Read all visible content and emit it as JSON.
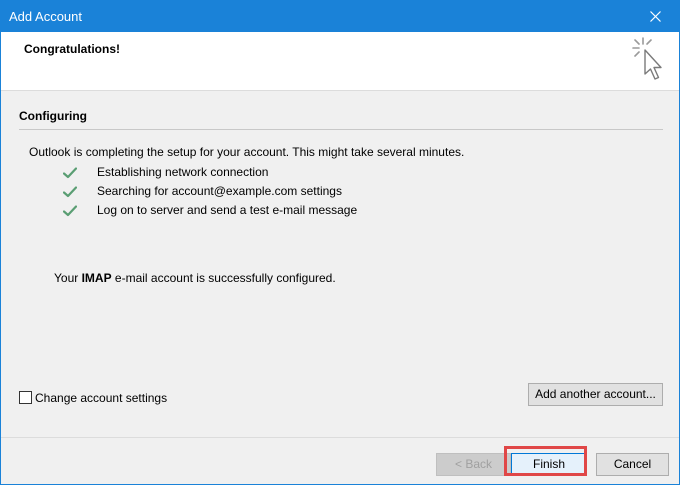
{
  "window": {
    "title": "Add Account",
    "close_icon": "close-icon",
    "accent_color": "#1a82d8"
  },
  "banner": {
    "heading": "Congratulations!",
    "icon": "wizard-cursor-icon"
  },
  "section": {
    "title": "Configuring",
    "intro": "Outlook is completing the setup for your account. This might take several minutes.",
    "steps": [
      {
        "label": "Establishing network connection",
        "status": "done",
        "icon": "check-icon"
      },
      {
        "label": "Searching for account@example.com settings",
        "status": "done",
        "icon": "check-icon"
      },
      {
        "label": "Log on to server and send a test e-mail message",
        "status": "done",
        "icon": "check-icon"
      }
    ],
    "success_prefix": "Your ",
    "success_bold": "IMAP",
    "success_suffix": " e-mail account is successfully configured."
  },
  "options": {
    "change_settings_label": "Change account settings",
    "change_settings_checked": false,
    "add_another_label": "Add another account..."
  },
  "footer": {
    "back_label": "< Back",
    "back_enabled": false,
    "finish_label": "Finish",
    "cancel_label": "Cancel",
    "highlight_color": "#e04747"
  }
}
